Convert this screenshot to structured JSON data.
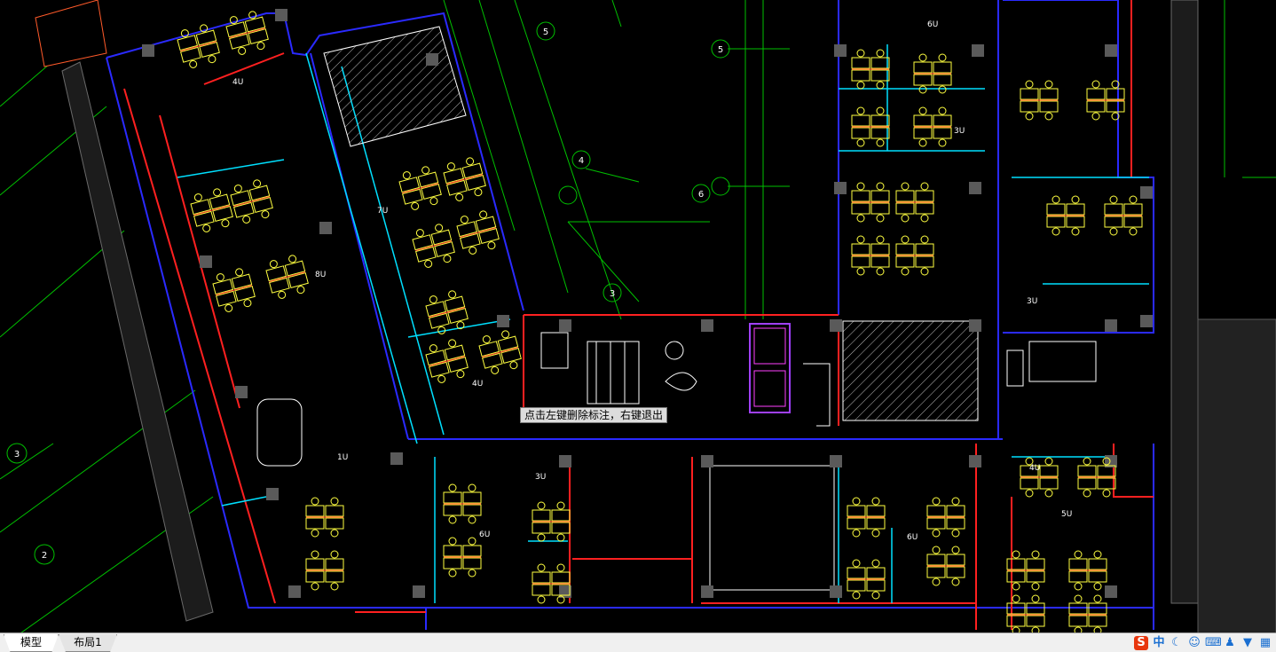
{
  "tooltip": {
    "text": "点击左键删除标注，右键退出"
  },
  "tabs": [
    {
      "label": "模型",
      "active": true
    },
    {
      "label": "布局1",
      "active": false
    }
  ],
  "tray": {
    "ime_logo": "S",
    "ime_lang": "中",
    "icons": [
      "moon-icon",
      "emoji-icon",
      "keyboard-icon",
      "user-icon",
      "shirt-icon",
      "grid-icon"
    ]
  },
  "axis_bubbles": [
    "5",
    "4",
    "5",
    "6",
    "3",
    "3",
    "2"
  ],
  "room_labels": [
    "4U",
    "6U",
    "3U",
    "7U",
    "8U",
    "1U",
    "4U",
    "3U",
    "6U",
    "4U",
    "3U",
    "6U",
    "5U"
  ],
  "colors": {
    "background": "#000000",
    "grid": "#00c800",
    "walls_blue": "#2020ff",
    "walls_red": "#ff1a1a",
    "furniture": "#ffff40",
    "cyan": "#00e5ff",
    "white": "#ffffff"
  }
}
